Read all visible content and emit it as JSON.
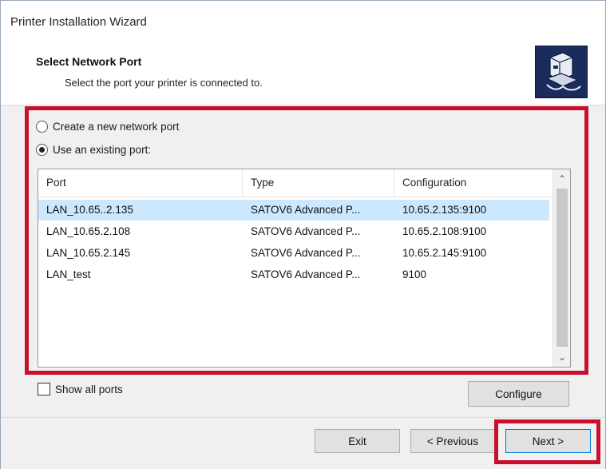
{
  "window": {
    "title": "Printer Installation Wizard"
  },
  "header": {
    "title": "Select Network Port",
    "subtitle": "Select the port your printer is connected to.",
    "icon": "printer-network-icon"
  },
  "options": {
    "create_new": {
      "label": "Create a new network port",
      "selected": false
    },
    "use_existing": {
      "label": "Use an existing port:",
      "selected": true
    }
  },
  "port_list": {
    "columns": [
      "Port",
      "Type",
      "Configuration"
    ],
    "rows": [
      {
        "port": "LAN_10.65..2.135",
        "type": "SATOV6 Advanced P...",
        "configuration": "10.65.2.135:9100",
        "selected": true
      },
      {
        "port": "LAN_10.65.2.108",
        "type": "SATOV6 Advanced P...",
        "configuration": "10.65.2.108:9100",
        "selected": false
      },
      {
        "port": "LAN_10.65.2.145",
        "type": "SATOV6 Advanced P...",
        "configuration": "10.65.2.145:9100",
        "selected": false
      },
      {
        "port": "LAN_test",
        "type": "SATOV6 Advanced P...",
        "configuration": "9100",
        "selected": false
      }
    ]
  },
  "show_all_ports": {
    "label": "Show all ports",
    "checked": false
  },
  "buttons": {
    "configure": "Configure",
    "exit": "Exit",
    "previous": "< Previous",
    "next": "Next >"
  },
  "colors": {
    "highlight_border": "#c8102e",
    "selected_row": "#cce8ff",
    "icon_background": "#1a2c5e"
  }
}
